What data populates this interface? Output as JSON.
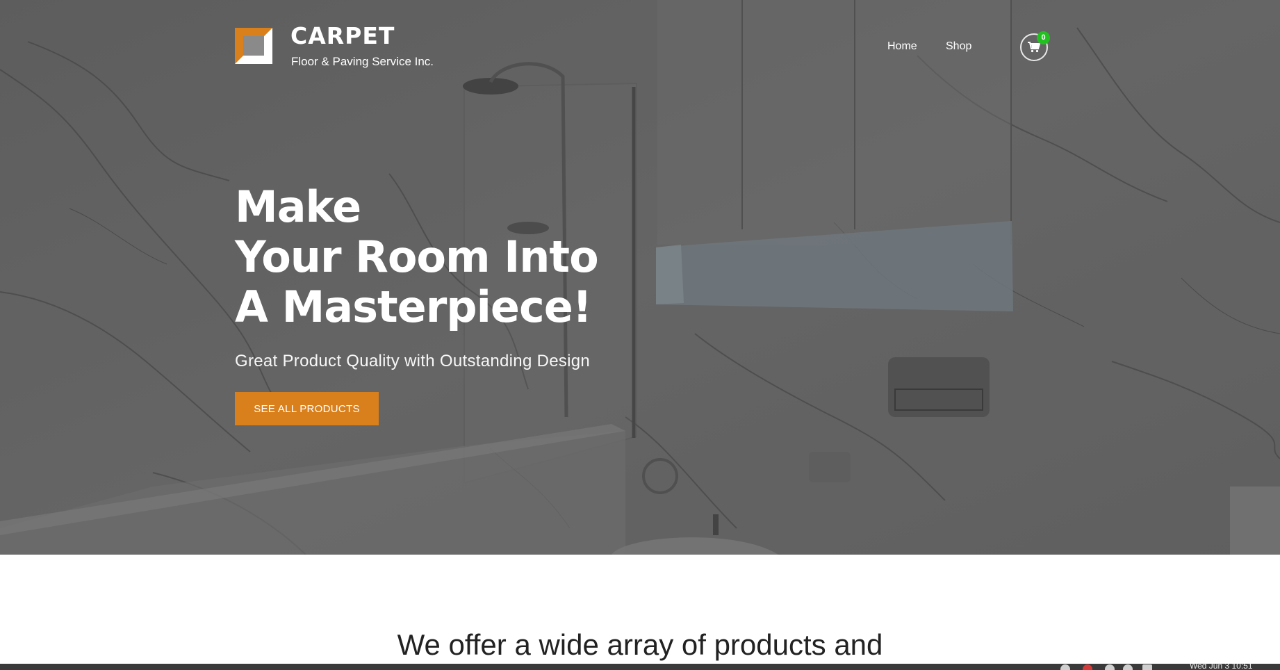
{
  "header": {
    "brand_name": "CARPET",
    "brand_tagline": "Floor & Paving Service Inc.",
    "logo_icon": "square-frame-logo-icon",
    "nav": [
      {
        "label": "Home"
      },
      {
        "label": "Shop"
      }
    ],
    "cart": {
      "icon": "shopping-cart-icon",
      "count": "0"
    }
  },
  "hero": {
    "headline_lines": [
      "Make",
      "Your Room Into",
      "A Masterpiece!"
    ],
    "subheadline": "Great Product Quality with Outstanding Design",
    "cta_label": "SEE ALL PRODUCTS"
  },
  "section": {
    "heading": "We offer a wide array of products and"
  },
  "taskbar": {
    "clock": "Wed Jun  3 10:51"
  },
  "colors": {
    "accent": "#d9801c",
    "badge": "#21c21f",
    "text_light": "#ffffff",
    "text_dark": "#222222"
  }
}
